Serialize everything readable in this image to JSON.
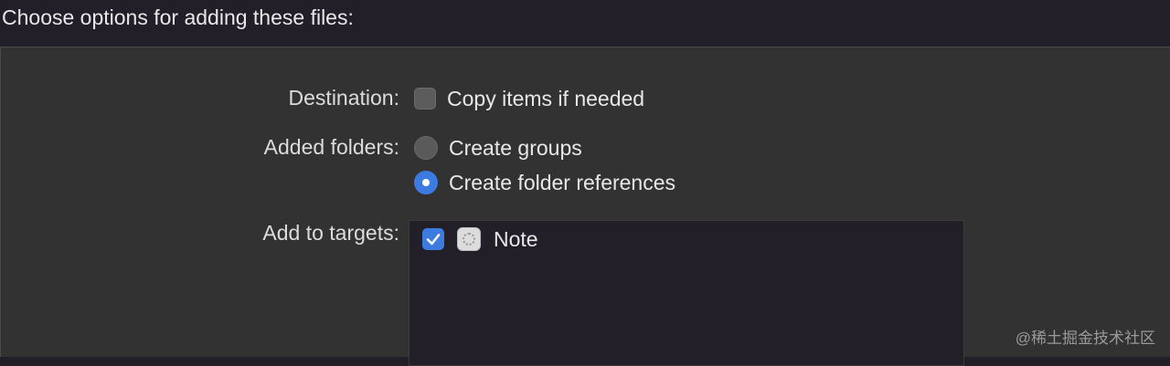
{
  "dialog": {
    "title": "Choose options for adding these files:"
  },
  "destination": {
    "label": "Destination:",
    "copy_items": {
      "label": "Copy items if needed",
      "checked": false
    }
  },
  "added_folders": {
    "label": "Added folders:",
    "options": [
      {
        "label": "Create groups",
        "selected": false
      },
      {
        "label": "Create folder references",
        "selected": true
      }
    ]
  },
  "targets": {
    "label": "Add to targets:",
    "items": [
      {
        "name": "Note",
        "checked": true,
        "icon": "app-target-icon"
      }
    ]
  },
  "watermark": "@稀土掘金技术社区",
  "colors": {
    "accent": "#3d7be0",
    "panel_bg": "#323232",
    "header_bg": "#221f29",
    "list_bg": "#221f29"
  }
}
